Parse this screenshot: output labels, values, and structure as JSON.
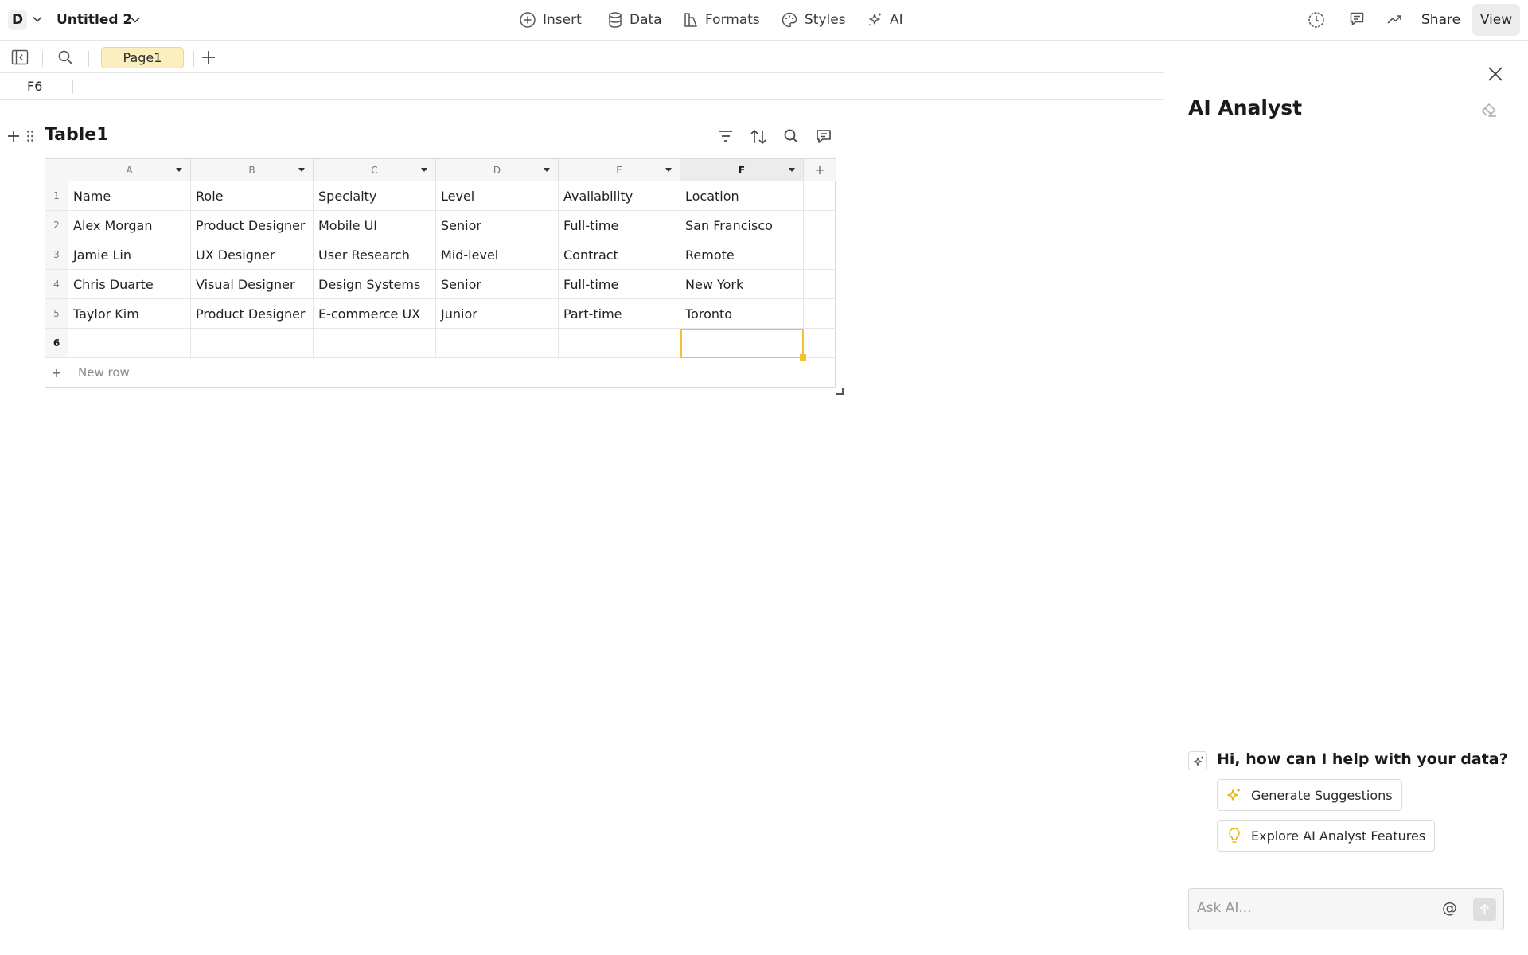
{
  "topbar": {
    "workspace_initial": "D",
    "doc_title": "Untitled 2",
    "menu": {
      "insert": "Insert",
      "data": "Data",
      "formats": "Formats",
      "styles": "Styles",
      "ai": "AI"
    },
    "share": "Share",
    "view": "View"
  },
  "pagebar": {
    "page_tab": "Page1"
  },
  "formula": {
    "cell_ref": "F6"
  },
  "table": {
    "name": "Table1",
    "columns": [
      "A",
      "B",
      "C",
      "D",
      "E",
      "F"
    ],
    "selected_column": "F",
    "row_numbers": [
      "1",
      "2",
      "3",
      "4",
      "5",
      "6"
    ],
    "rows": [
      [
        "Name",
        "Role",
        "Specialty",
        "Level",
        "Availability",
        "Location"
      ],
      [
        "Alex Morgan",
        "Product Designer",
        "Mobile UI",
        "Senior",
        "Full-time",
        "San Francisco"
      ],
      [
        "Jamie Lin",
        "UX Designer",
        "User Research",
        "Mid-level",
        "Contract",
        "Remote"
      ],
      [
        "Chris Duarte",
        "Visual Designer",
        "Design Systems",
        "Senior",
        "Full-time",
        "New York"
      ],
      [
        "Taylor Kim",
        "Product Designer",
        "E-commerce UX",
        "Junior",
        "Part-time",
        "Toronto"
      ],
      [
        "",
        "",
        "",
        "",
        "",
        ""
      ]
    ],
    "add_column": "+",
    "new_row_plus": "+",
    "new_row": "New row"
  },
  "ai_panel": {
    "title": "AI Analyst",
    "greeting": "Hi, how can I help with your data?",
    "chips": [
      "Generate Suggestions",
      "Explore AI Analyst Features"
    ],
    "input_placeholder": "Ask AI...",
    "mention": "@"
  },
  "colors": {
    "accent_yellow": "#f2c230",
    "tab_bg": "#fcefbf"
  }
}
